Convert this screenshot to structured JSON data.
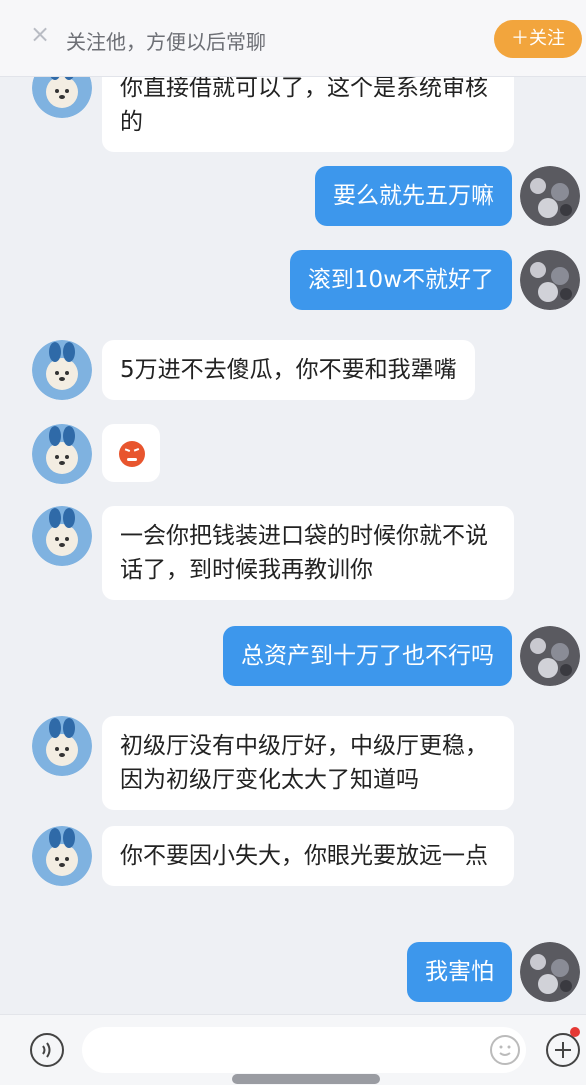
{
  "header": {
    "close_icon": "×",
    "prompt": "关注他，方便以后常聊",
    "follow_label": "＋关注"
  },
  "messages": [
    {
      "side": "in",
      "text": "你直接借就可以了，这个是系统审核的"
    },
    {
      "side": "out",
      "text": "要么就先五万嘛"
    },
    {
      "side": "out",
      "text": "滚到10w不就好了"
    },
    {
      "side": "in",
      "text": "5万进不去傻瓜，你不要和我犟嘴"
    },
    {
      "side": "in",
      "emoji": "angry-face"
    },
    {
      "side": "in",
      "text": "一会你把钱装进口袋的时候你就不说话了，到时候我再教训你"
    },
    {
      "side": "out",
      "text": "总资产到十万了也不行吗"
    },
    {
      "side": "in",
      "text": "初级厅没有中级厅好，中级厅更稳，因为初级厅变化太大了知道吗"
    },
    {
      "side": "in",
      "text": "你不要因小失大，你眼光要放远一点"
    },
    {
      "side": "out",
      "text": "我害怕"
    }
  ],
  "colors": {
    "outgoing_bubble": "#3d97ec",
    "incoming_bubble": "#ffffff",
    "follow_button": "#f2a53d",
    "background": "#eef0f4"
  },
  "input_bar": {
    "voice_icon": "voice-icon",
    "emoji_icon": "smile-icon",
    "plus_icon": "plus-icon"
  }
}
